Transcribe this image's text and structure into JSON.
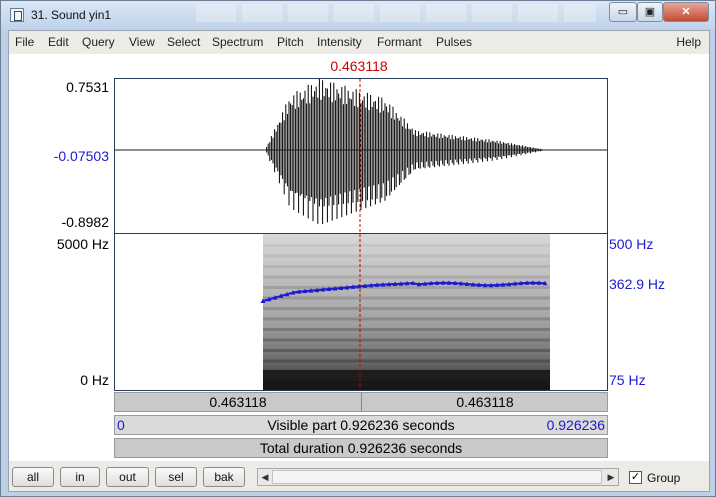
{
  "window": {
    "title": "31. Sound yin1",
    "min_glyph": "▭",
    "max_glyph": "▣",
    "close_glyph": "✕"
  },
  "menu": {
    "items": [
      "File",
      "Edit",
      "Query",
      "View",
      "Select",
      "Spectrum",
      "Pitch",
      "Intensity",
      "Formant",
      "Pulses"
    ],
    "help": "Help"
  },
  "cursor": {
    "time_label": "0.463118",
    "time": 0.463118
  },
  "waveform": {
    "y_top": "0.7531",
    "y_mid": "-0.07503",
    "y_bottom": "-0.8982"
  },
  "spectrogram": {
    "freq_top": "5000 Hz",
    "freq_bottom": "0 Hz"
  },
  "pitch": {
    "top": "500 Hz",
    "value": "362.9 Hz",
    "bottom": "75 Hz"
  },
  "bars": {
    "left_time": "0.463118",
    "right_time": "0.463118",
    "visible_start": "0",
    "visible_text": "Visible part 0.926236 seconds",
    "visible_end": "0.926236",
    "total_text": "Total duration 0.926236 seconds"
  },
  "controls": {
    "all": "all",
    "in": "in",
    "out": "out",
    "sel": "sel",
    "bak": "bak",
    "scroll_left": "◀",
    "scroll_right": "▶",
    "group_checked": "✓",
    "group_label": "Group"
  },
  "colors": {
    "cursor": "#d00000",
    "pitch_line": "#1b1bd0",
    "axis_blue": "#1b1bd0"
  }
}
